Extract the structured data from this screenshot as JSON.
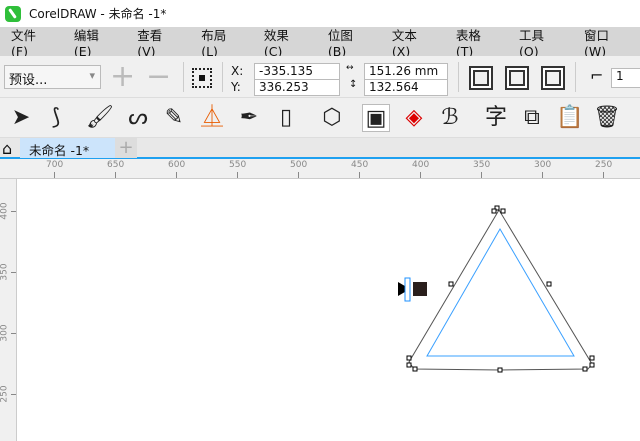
{
  "window": {
    "title": "CorelDRAW - 未命名 -1*"
  },
  "menu": [
    "文件(F)",
    "编辑(E)",
    "查看(V)",
    "布局(L)",
    "效果(C)",
    "位图(B)",
    "文本(X)",
    "表格(T)",
    "工具(O)",
    "窗口(W)"
  ],
  "property_bar": {
    "preset": "预设...",
    "x_label": "X:",
    "y_label": "Y:",
    "x_value": "-335.135 mm",
    "y_value": "336.253 mm",
    "width_value": "151.26 mm",
    "height_value": "132.564 mm",
    "steps_value": "1"
  },
  "tabs": [
    {
      "label": "未命名 -1*"
    }
  ],
  "ruler": {
    "horizontal": [
      700,
      650,
      600,
      550,
      500,
      450,
      400,
      350,
      300,
      250
    ],
    "vertical": [
      400,
      350,
      300,
      250
    ]
  },
  "colors": {
    "accent": "#1ea0f0",
    "contour_blue": "#3aa0ff",
    "menu_bg": "#d6d6d6"
  }
}
